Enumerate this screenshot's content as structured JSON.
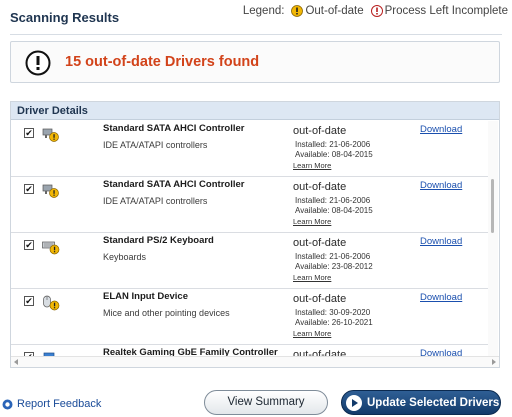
{
  "header": {
    "title": "Scanning Results",
    "legend_label": "Legend:",
    "legend_items": [
      "Out-of-date",
      "Process Left Incomplete"
    ]
  },
  "banner": {
    "message": "15 out-of-date Drivers found"
  },
  "details": {
    "header": "Driver Details",
    "rows": [
      {
        "checked": true,
        "icon": "sata-controller-icon",
        "name": "Standard SATA AHCI Controller",
        "category": "IDE ATA/ATAPI controllers",
        "status": "out-of-date",
        "installed": "Installed: 21-06-2006",
        "available": "Available: 08-04-2015",
        "learn_more": "Learn More",
        "download": "Download"
      },
      {
        "checked": true,
        "icon": "sata-controller-icon",
        "name": "Standard SATA AHCI Controller",
        "category": "IDE ATA/ATAPI controllers",
        "status": "out-of-date",
        "installed": "Installed: 21-06-2006",
        "available": "Available: 08-04-2015",
        "learn_more": "Learn More",
        "download": "Download"
      },
      {
        "checked": true,
        "icon": "keyboard-icon",
        "name": "Standard PS/2 Keyboard",
        "category": "Keyboards",
        "status": "out-of-date",
        "installed": "Installed: 21-06-2006",
        "available": "Available: 23-08-2012",
        "learn_more": "Learn More",
        "download": "Download"
      },
      {
        "checked": true,
        "icon": "mouse-icon",
        "name": "ELAN Input Device",
        "category": "Mice and other pointing devices",
        "status": "out-of-date",
        "installed": "Installed: 30-09-2020",
        "available": "Available: 26-10-2021",
        "learn_more": "Learn More",
        "download": "Download"
      },
      {
        "checked": true,
        "icon": "network-adapter-icon",
        "name": "Realtek Gaming GbE Family Controller",
        "category": "",
        "status": "out-of-date",
        "installed": "",
        "available": "",
        "learn_more": "",
        "download": "Download"
      }
    ]
  },
  "footer": {
    "report_feedback": "Report Feedback",
    "view_summary": "View Summary",
    "update_selected": "Update Selected Drivers"
  },
  "colors": {
    "accent_red": "#d2431a",
    "link_blue": "#1a4fae",
    "primary_button": "#123a6a",
    "warning_yellow": "#f2b705"
  }
}
